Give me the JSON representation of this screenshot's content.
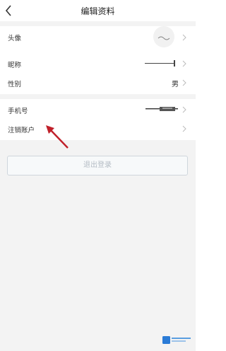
{
  "header": {
    "title": "编辑资料",
    "back_icon": "back-arrow-icon"
  },
  "rows": {
    "avatar": {
      "label": "头像"
    },
    "nickname": {
      "label": "昵称"
    },
    "gender": {
      "label": "性别",
      "value": "男"
    },
    "phone": {
      "label": "手机号"
    },
    "cancel_account": {
      "label": "注销账户"
    }
  },
  "logout": {
    "label": "退出登录"
  },
  "colors": {
    "separator": "#f3f3f3",
    "annotation_arrow": "#c0202a",
    "logout_border": "#cfd6dc"
  }
}
